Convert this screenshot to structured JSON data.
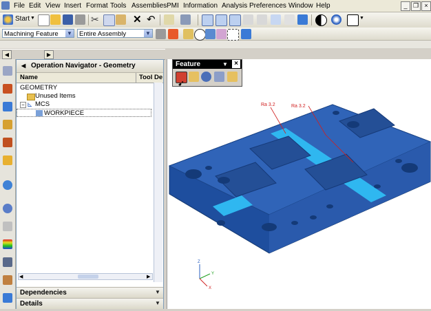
{
  "menubar": {
    "items": [
      "File",
      "Edit",
      "View",
      "Insert",
      "Format",
      "Tools",
      "Assemblies",
      "PMI",
      "Information",
      "Analysis",
      "Preferences",
      "Window",
      "Help"
    ]
  },
  "toolbar1": {
    "start_label": "Start"
  },
  "toolbar2": {
    "filter_combo": "Machining Feature",
    "scope_combo": "Entire Assembly"
  },
  "navigator": {
    "title": "Operation Navigator - Geometry",
    "col_name": "Name",
    "col_tool": "Tool De",
    "rows": [
      "GEOMETRY",
      "Unused Items",
      "MCS",
      "WORKPIECE"
    ]
  },
  "panels": {
    "dependencies": "Dependencies",
    "details": "Details"
  },
  "feature_palette": {
    "title": "Feature"
  },
  "viewport": {
    "annotations": [
      "Ra 3.2",
      "Ra 3.2"
    ],
    "triad": {
      "x": "X",
      "y": "Y",
      "z": "Z"
    },
    "part_color": "#2f5fb3",
    "slot_color": "#2fb7f0"
  }
}
